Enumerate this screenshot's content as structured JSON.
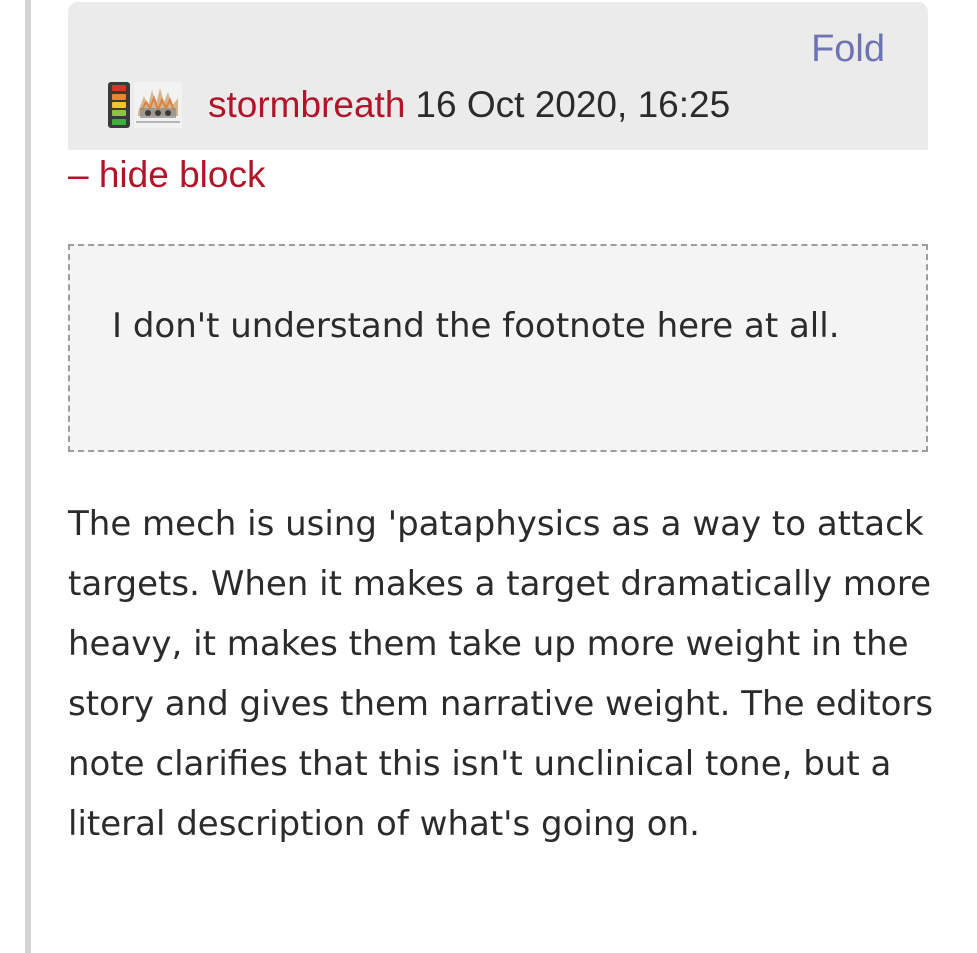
{
  "comment": {
    "fold_label": "Fold",
    "author": "stormbreath",
    "timestamp": "16 Oct 2020, 16:25",
    "hide_block_label": "– hide block",
    "quote_text": "I don't understand the footnote here at all.",
    "body_text": "The mech is using 'pataphysics as a way to attack targets. When it makes a target dramatically more heavy, it makes them take up more weight in the story and gives them narrative weight. The editors note clarifies that this isn't unclinical tone, but a literal description of what's going on."
  },
  "icons": {
    "rating": "rating-meter-icon",
    "avatar": "user-avatar"
  },
  "colors": {
    "link_red": "#b0152a",
    "fold_link": "#6e74b3",
    "header_bg": "#ebebeb",
    "quote_bg": "#f4f4f4",
    "rating_levels": [
      "#d9342b",
      "#e38a2c",
      "#f2c230",
      "#8fc43b",
      "#3dae3d"
    ]
  }
}
